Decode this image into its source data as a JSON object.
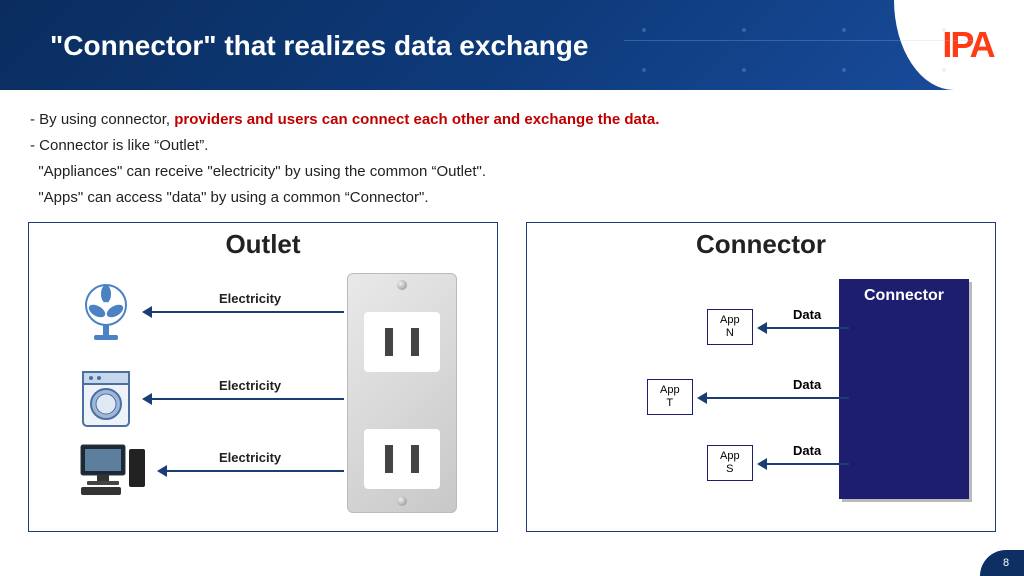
{
  "header": {
    "title": "\"Connector\" that realizes data exchange",
    "logo": "IPA"
  },
  "body": {
    "line1_lead": "- By using connector, ",
    "line1_highlight": "providers and users can connect each other and exchange the data.",
    "line2": "- Connector is like “Outlet”.",
    "line3": "  \"Appliances\" can receive \"electricity\" by using the common “Outlet\".",
    "line4": "  \"Apps\" can access \"data\" by using a common “Connector\"."
  },
  "panels": {
    "outlet": {
      "title": "Outlet",
      "label": "Electricity",
      "appliances": [
        "fan",
        "washer",
        "pc"
      ]
    },
    "connector": {
      "title": "Connector",
      "box_label": "Connector",
      "arrow_label": "Data",
      "apps": [
        {
          "line1": "App",
          "line2": "N"
        },
        {
          "line1": "App",
          "line2": "T"
        },
        {
          "line1": "App",
          "line2": "S"
        }
      ]
    }
  },
  "page_number": "8"
}
